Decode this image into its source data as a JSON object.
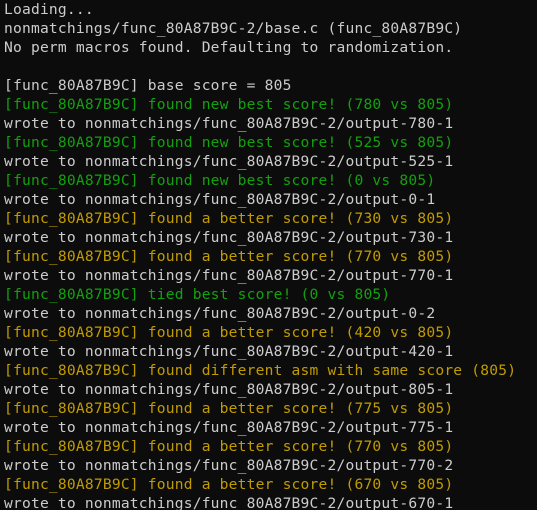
{
  "terminal": {
    "colors": {
      "background": "#0c0c0c",
      "default": "#cccccc",
      "green": "#13a10e",
      "yellow": "#c19c00"
    },
    "lines": [
      {
        "text": "Loading...",
        "color": "default"
      },
      {
        "text": "nonmatchings/func_80A87B9C-2/base.c (func_80A87B9C)",
        "color": "default"
      },
      {
        "text": "No perm macros found. Defaulting to randomization.",
        "color": "default"
      },
      {
        "text": "",
        "color": "default"
      },
      {
        "text": "[func_80A87B9C] base score = 805",
        "color": "default"
      },
      {
        "text": "[func_80A87B9C] found new best score! (780 vs 805)",
        "color": "green"
      },
      {
        "text": "wrote to nonmatchings/func_80A87B9C-2/output-780-1",
        "color": "default"
      },
      {
        "text": "[func_80A87B9C] found new best score! (525 vs 805)",
        "color": "green"
      },
      {
        "text": "wrote to nonmatchings/func_80A87B9C-2/output-525-1",
        "color": "default"
      },
      {
        "text": "[func_80A87B9C] found new best score! (0 vs 805)",
        "color": "green"
      },
      {
        "text": "wrote to nonmatchings/func_80A87B9C-2/output-0-1",
        "color": "default"
      },
      {
        "text": "[func_80A87B9C] found a better score! (730 vs 805)",
        "color": "yellow"
      },
      {
        "text": "wrote to nonmatchings/func_80A87B9C-2/output-730-1",
        "color": "default"
      },
      {
        "text": "[func_80A87B9C] found a better score! (770 vs 805)",
        "color": "yellow"
      },
      {
        "text": "wrote to nonmatchings/func_80A87B9C-2/output-770-1",
        "color": "default"
      },
      {
        "text": "[func_80A87B9C] tied best score! (0 vs 805)",
        "color": "green"
      },
      {
        "text": "wrote to nonmatchings/func_80A87B9C-2/output-0-2",
        "color": "default"
      },
      {
        "text": "[func_80A87B9C] found a better score! (420 vs 805)",
        "color": "yellow"
      },
      {
        "text": "wrote to nonmatchings/func_80A87B9C-2/output-420-1",
        "color": "default"
      },
      {
        "text": "[func_80A87B9C] found different asm with same score (805)",
        "color": "yellow"
      },
      {
        "text": "wrote to nonmatchings/func_80A87B9C-2/output-805-1",
        "color": "default"
      },
      {
        "text": "[func_80A87B9C] found a better score! (775 vs 805)",
        "color": "yellow"
      },
      {
        "text": "wrote to nonmatchings/func_80A87B9C-2/output-775-1",
        "color": "default"
      },
      {
        "text": "[func_80A87B9C] found a better score! (770 vs 805)",
        "color": "yellow"
      },
      {
        "text": "wrote to nonmatchings/func_80A87B9C-2/output-770-2",
        "color": "default"
      },
      {
        "text": "[func_80A87B9C] found a better score! (670 vs 805)",
        "color": "yellow"
      },
      {
        "text": "wrote to nonmatchings/func_80A87B9C-2/output-670-1",
        "color": "default"
      }
    ]
  }
}
